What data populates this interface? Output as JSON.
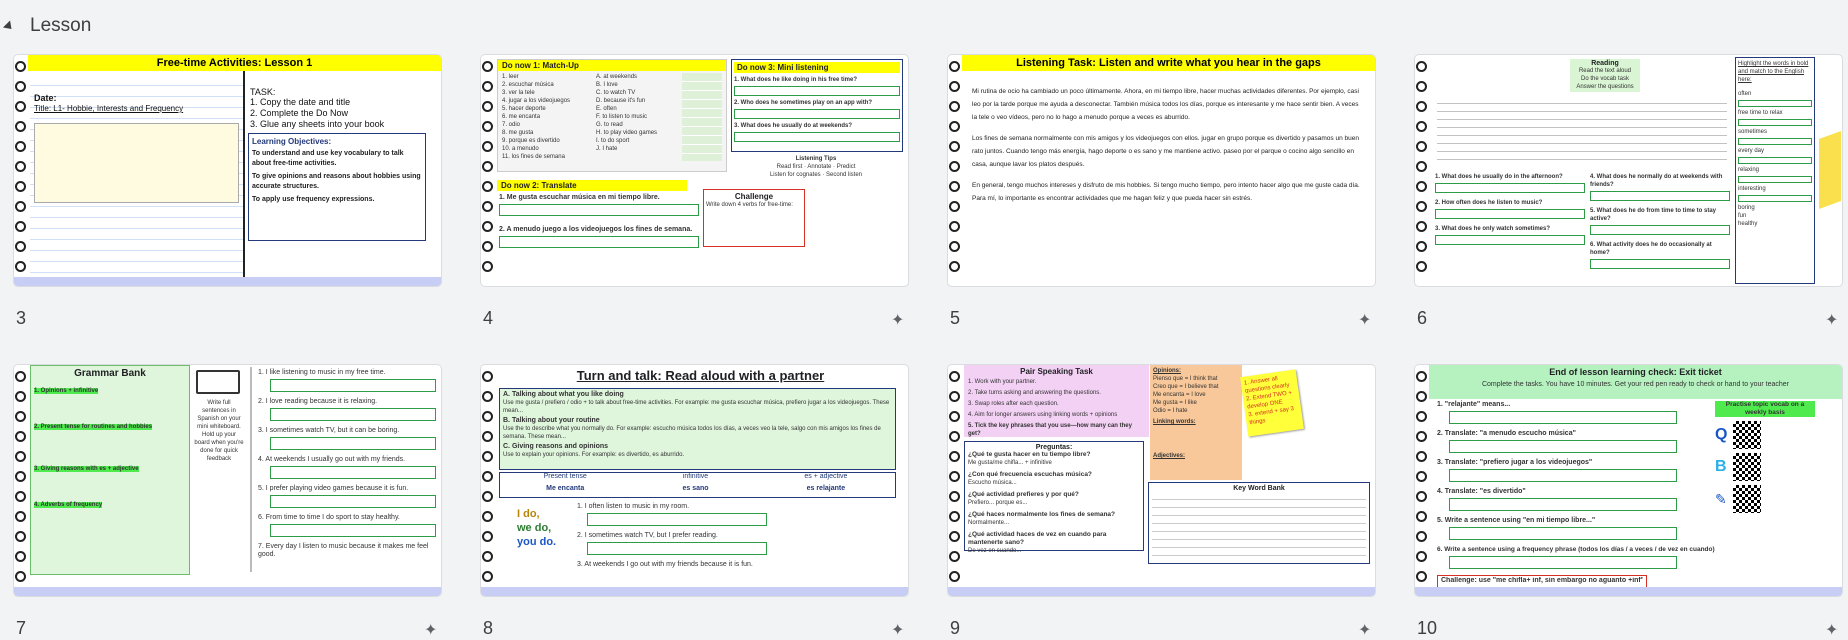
{
  "section": {
    "label": "Lesson"
  },
  "slides": [
    {
      "number": "3",
      "title": "Free-time Activities: Lesson 1",
      "date": "Date:",
      "subtitle": "Title: L1- Hobbie, Interests and Frequency",
      "task_head": "TASK:",
      "tasks": [
        "1. Copy the date and title",
        "2. Complete the Do Now",
        "3. Glue any sheets into your book"
      ],
      "objectives_head": "Learning Objectives:",
      "objectives": [
        "To understand and use key vocabulary to talk about free-time activities.",
        "To give opinions and reasons about hobbies using accurate structures.",
        "To apply use frequency expressions."
      ]
    },
    {
      "number": "4",
      "doNow1": "Do now 1: Match-Up",
      "doNow3": "Do now 3: Mini listening",
      "doNow2": "Do now 2: Translate",
      "left_items": [
        "1. leer",
        "2. escuchar música",
        "3. ver la tele",
        "4. jugar a los videojuegos",
        "5. hacer deporte",
        "6. me encanta",
        "7. odio",
        "8. me gusta",
        "9. porque es divertido",
        "10. a menudo",
        "11. los fines de semana"
      ],
      "right_items": [
        "A. at weekends",
        "B. I love",
        "C. to watch TV",
        "D. because it's fun",
        "E. often",
        "F. to listen to music",
        "G. to read",
        "H. to play video games",
        "I. to do sport",
        "J. I hate"
      ],
      "listen_q": [
        "1. What does he like doing in his free time?",
        "2. Who does he sometimes play on an app with?",
        "3. What does he usually do at weekends?"
      ],
      "translate": [
        "1. Me gusta escuchar música en mi tiempo libre.",
        "2. A menudo juego a los videojuegos los fines de semana."
      ],
      "challenge_head": "Challenge",
      "challenge_text": "Write down 4 verbs for free-time:",
      "tips_head": "Listening Tips",
      "tips": [
        "Read first",
        "Annotate",
        "Predict",
        "Listen for cognates",
        "Second listen"
      ]
    },
    {
      "number": "5",
      "title": "Listening Task: Listen and write what you hear in the gaps",
      "p1": "Mi rutina de ocio ha cambiado un poco últimamente. Ahora, en mi tiempo libre, hacer muchas actividades diferentes. Por ejemplo, casi leo por la tarde porque me ayuda a desconectar. También música todos los días, porque es interesante y me hace sentir bien. A veces la tele o veo vídeos, pero no lo hago a menudo porque a veces es aburrido.",
      "p2": "Los fines de semana normalmente con mis amigos y los videojuegos con ellos. jugar en grupo porque es divertido y pasamos un buen rato juntos. Cuando tengo más energía, hago deporte o es sano y me mantiene activo. paseo por el parque o cocino algo sencillo en casa, aunque lavar los platos después.",
      "p3": "En general, tengo muchos intereses y disfruto de mis hobbies. Si tengo mucho tiempo, pero intento hacer algo que me guste cada día. Para mí, lo importante es encontrar actividades que me hagan feliz y que pueda hacer sin estrés."
    },
    {
      "number": "6",
      "reading": "Reading",
      "reading_steps": [
        "Read the text aloud",
        "Do the vocab task",
        "Answer the questions"
      ],
      "vocab_head": "Highlight the words in bold and match to the English here:",
      "vocab": [
        "often",
        "free time to relax",
        "sometimes",
        "every day",
        "relaxing",
        "interesting",
        "boring",
        "fun",
        "healthy"
      ],
      "questions": [
        "1. What does he usually do in the afternoon?",
        "2. How often does he listen to music?",
        "3. What does he only watch sometimes?",
        "4. What does he normally do at weekends with friends?",
        "5. What does he do from time to time to stay active?",
        "6. What activity does he do occasionally at home?"
      ]
    },
    {
      "number": "7",
      "title": "Grammar Bank",
      "sections": [
        "1. Opinions + infinitive",
        "2. Present tense for routines and hobbies",
        "3. Giving reasons with es + adjective",
        "4. Adverbs of frequency"
      ],
      "whiteboard": "Write full sentences in Spanish on your mini whiteboard. Hold up your board when you're done for quick feedback",
      "prompts": [
        "1. I like listening to music in my free time.",
        "2. I love reading because it is relaxing.",
        "3. I sometimes watch TV, but it can be boring.",
        "4. At weekends I usually go out with my friends.",
        "5. I prefer playing video games because it is fun.",
        "6. From time to time I do sport to stay healthy.",
        "7. Every day I listen to music because it makes me feel good."
      ]
    },
    {
      "number": "8",
      "title": "Turn and talk: Read aloud with a partner",
      "a_head": "A. Talking about what you like doing",
      "a_text": "Use me gusta / prefiero / odio + to talk about free-time activities. For example: me gusta escuchar música, prefiero jugar a los videojuegos. These mean...",
      "b_head": "B. Talking about your routine",
      "b_text": "Use the to describe what you normally do. For example: escucho música todos los días, a veces veo la tele, salgo con mis amigos los fines de semana. These mean...",
      "c_head": "C. Giving reasons and opinions",
      "c_text": "Use to explain your opinions. For example: es divertido, es aburrido.",
      "table_heads": [
        "Present tense",
        "infinitive",
        "es + adjective"
      ],
      "table_vals": [
        "Me encanta",
        "es sano",
        "es relajante"
      ],
      "pron": [
        "I do,",
        "we do,",
        "you do."
      ],
      "prompts": [
        "1. I often listen to music in my room.",
        "2. I sometimes watch TV, but I prefer reading.",
        "3. At weekends I go out with my friends because it is fun."
      ]
    },
    {
      "number": "9",
      "title": "Pair Speaking Task",
      "steps": [
        "1. Work with your partner.",
        "2. Take turns asking and answering the questions.",
        "3. Swap roles after each question.",
        "4. Aim for longer answers using linking words + opinions",
        "5. Tick the key phrases that you use—how many can they get?"
      ],
      "opinions_head": "Opinions:",
      "opinions": [
        "Pienso que = I think that",
        "Creo que = I believe that",
        "Me encanta = I love",
        "Me gusta = I like",
        "Odio = I hate"
      ],
      "linking_head": "Linking words:",
      "adjectives_head": "Adjectives:",
      "sticky": [
        "1. Answer all questions clearly",
        "2. Extend TWO + develop ONE",
        "3. extend + say 3 things"
      ],
      "preguntas_head": "Preguntas:",
      "preguntas": [
        "¿Qué te gusta hacer en tu tiempo libre?",
        "¿Con qué frecuencia escuchas música?",
        "¿Qué actividad prefieres y por qué?",
        "¿Qué haces normalmente los fines de semana?",
        "¿Qué actividad haces de vez en cuando para mantenerte sano?"
      ],
      "starters": [
        "Me gusta/me chifla... + infinitive",
        "Escucho música...",
        "Prefiero... porque es...",
        "Normalmente...",
        "De vez en cuando..."
      ],
      "kwb_head": "Key Word Bank"
    },
    {
      "number": "10",
      "title": "End of lesson learning check: Exit ticket",
      "instr": "Complete the tasks. You have 10 minutes. Get your red pen ready to check or hand to your teacher",
      "items": [
        "1. \"relajante\" means...",
        "2. Translate: \"a menudo escucho música\"",
        "3. Translate: \"prefiero jugar a los videojuegos\"",
        "4. Translate: \"es divertido\"",
        "5. Write a sentence using \"en mi tiempo libre...\"",
        "6. Write a sentence using a frequency phrase (todos los días / a veces / de vez en cuando)"
      ],
      "challenge": "Challenge: use \"me chifla+ inf, sin embargo no aguanto +inf\" in Q6",
      "practice_head": "Practise topic vocab on a weekly basis"
    }
  ]
}
